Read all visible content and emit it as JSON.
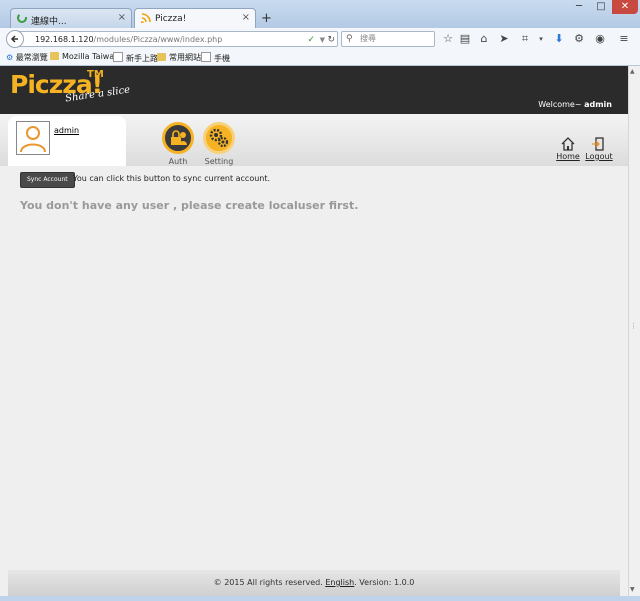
{
  "window": {
    "min_label": "─",
    "max_label": "□",
    "close_label": "✕"
  },
  "tabs": [
    {
      "label": "連線中...",
      "close": "×"
    },
    {
      "label": "Piczza!",
      "close": "×"
    }
  ],
  "new_tab": "+",
  "nav": {
    "url_host": "192.168.1.120",
    "url_path": "/modules/Piczza/www/index.php",
    "search_placeholder": "搜尋"
  },
  "bookmarks": [
    {
      "label": "最常瀏覽",
      "icon": "gear-icon"
    },
    {
      "label": "Mozilla Taiwan",
      "icon": "folder-icon"
    },
    {
      "label": "新手上路",
      "icon": "page-icon"
    },
    {
      "label": "常用網站",
      "icon": "folder-icon"
    },
    {
      "label": "手機",
      "icon": "page-icon"
    }
  ],
  "app": {
    "logo": "Piczza!",
    "logo_tm": "TM",
    "slogan": "Share a slice",
    "welcome_prefix": "Welcome~",
    "welcome_user": "admin"
  },
  "user": {
    "name": "admin"
  },
  "toolbar": {
    "auth_label": "Auth",
    "setting_label": "Setting",
    "home_label": "Home",
    "logout_label": "Logout"
  },
  "content": {
    "sync_button": "Sync Account",
    "sync_message": "You can click this button to sync current account.",
    "empty_message": "You don't have any user , please create localuser first."
  },
  "footer": {
    "copyright": "© 2015 All rights reserved.",
    "language": "English",
    "version_prefix": ". Version: ",
    "version": "1.0.0"
  },
  "colors": {
    "accent": "#f5b324",
    "header": "#2b2b2b"
  }
}
